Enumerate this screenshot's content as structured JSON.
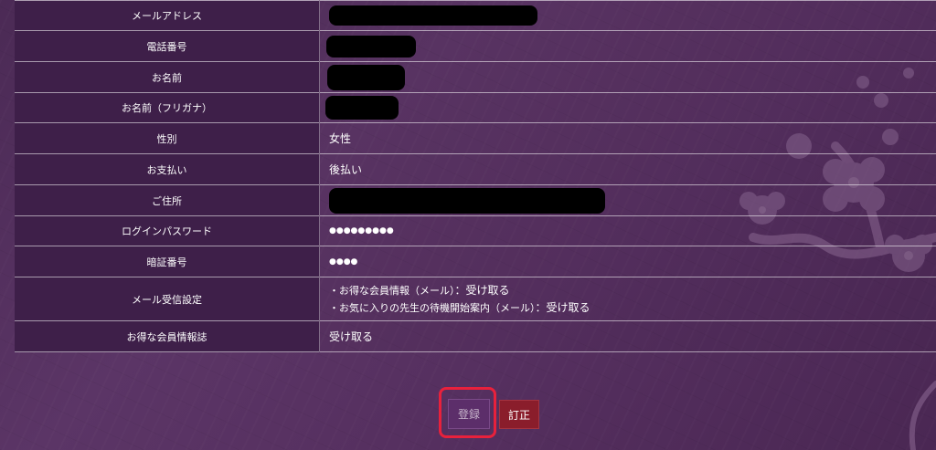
{
  "rows": [
    {
      "label": "メールアドレス"
    },
    {
      "label": "電話番号"
    },
    {
      "label": "お名前"
    },
    {
      "label": "お名前（フリガナ）"
    },
    {
      "label": "性別",
      "value": "女性"
    },
    {
      "label": "お支払い",
      "value": "後払い"
    },
    {
      "label": "ご住所"
    },
    {
      "label": "ログインパスワード",
      "value": "●●●●●●●●●"
    },
    {
      "label": "暗証番号",
      "value": "●●●●"
    },
    {
      "label": "メール受信設定",
      "lines": [
        {
          "text": "・お得な会員情報（メール）",
          "value": "：受け取る"
        },
        {
          "text": "・お気に入りの先生の待機開始案内（メール）",
          "value": "：受け取る"
        }
      ]
    },
    {
      "label": "お得な会員情報誌",
      "value": "受け取る"
    }
  ],
  "buttons": {
    "register_label": "登録",
    "correct_label": "訂正"
  },
  "colors": {
    "background": "#563060",
    "label_cell": "#3e1f49",
    "register_button": "#5c2e6a",
    "correct_button": "#8a1d2b",
    "highlight": "#e8213c"
  }
}
